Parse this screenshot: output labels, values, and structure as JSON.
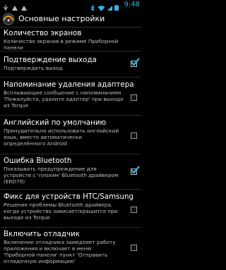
{
  "status_bar": {
    "time": "9:48",
    "left_icons": [
      "usb-icon",
      "notification-icon",
      "notification-icon"
    ],
    "right_icons": [
      "bluetooth-icon",
      "wifi-icon",
      "signal-icon",
      "battery-icon"
    ]
  },
  "action_bar": {
    "title": "Основные настройки"
  },
  "settings": [
    {
      "title": "Количество экранов",
      "summary": "Количество экранов в режиме Приборной панели",
      "checkbox": null
    },
    {
      "title": "Подтверждение выхода",
      "summary": "Подтверждать выход",
      "checkbox": true
    },
    {
      "title": "Напоминание удаления адаптера",
      "summary": "Всплывающее сообщение с напоминанием 'Пожалуйста, удалите адаптер' при выходе из Torque",
      "checkbox": false
    },
    {
      "title": "Английский по умолчанию",
      "summary": "Принудительно использовать английский язык, вместо автоматически определённого Android",
      "checkbox": false
    },
    {
      "title": "Ошибка Bluetooth",
      "summary": "Показывать предупреждение для устройств с 'плохим' Bluetooth драйвером (ERD79)",
      "checkbox": true
    },
    {
      "title": "Фикс для устройств HTC/Samsung",
      "summary": "Решение проблемы Bluetooth драйвера, когда устройство зависает/крашится при выходе из Torque",
      "checkbox": false
    },
    {
      "title": "Включить отладчик",
      "summary": "Включение отладчика замедляет работу приложения и включает в меню 'Приборной панели' пункт 'Отправить отладочную информацию'",
      "checkbox": false
    }
  ],
  "colors": {
    "accent": "#33b5e5",
    "check": "#33b5e5"
  }
}
